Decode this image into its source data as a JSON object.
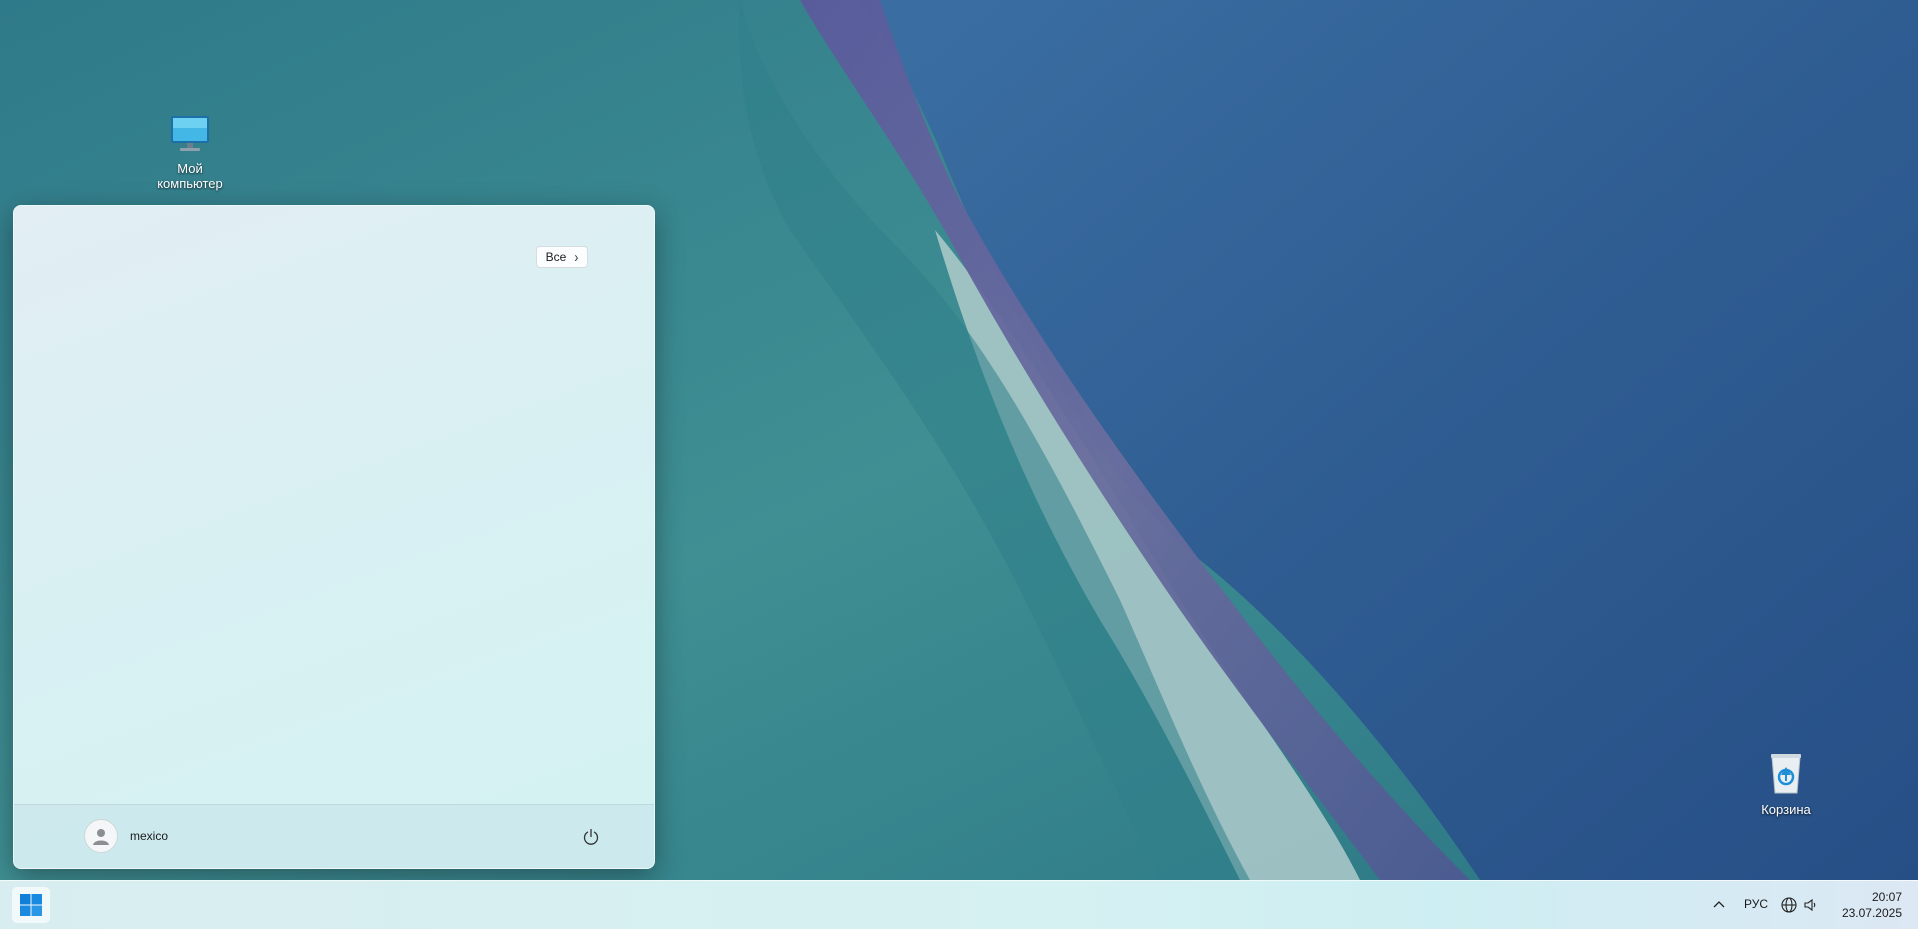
{
  "desktop": {
    "icons": [
      {
        "label": "Мой\nкомпьютер",
        "icon": "monitor-icon"
      },
      {
        "label": "Корзина",
        "icon": "recycle-bin-icon"
      }
    ]
  },
  "start_menu": {
    "all_apps_label": "Все",
    "user_name": "mexico",
    "power_icon": "power-icon"
  },
  "taskbar": {
    "start_icon": "windows-logo-icon",
    "tray": {
      "overflow_icon": "chevron-up-icon",
      "language": "РУС",
      "network_icon": "globe-icon",
      "volume_icon": "speaker-icon"
    },
    "clock": {
      "time": "20:07",
      "date": "23.07.2025"
    }
  },
  "colors": {
    "accent_blue": "#0078d4",
    "start_menu_bg": "#d9f0f3",
    "taskbar_bg": "#d6f1f2"
  }
}
